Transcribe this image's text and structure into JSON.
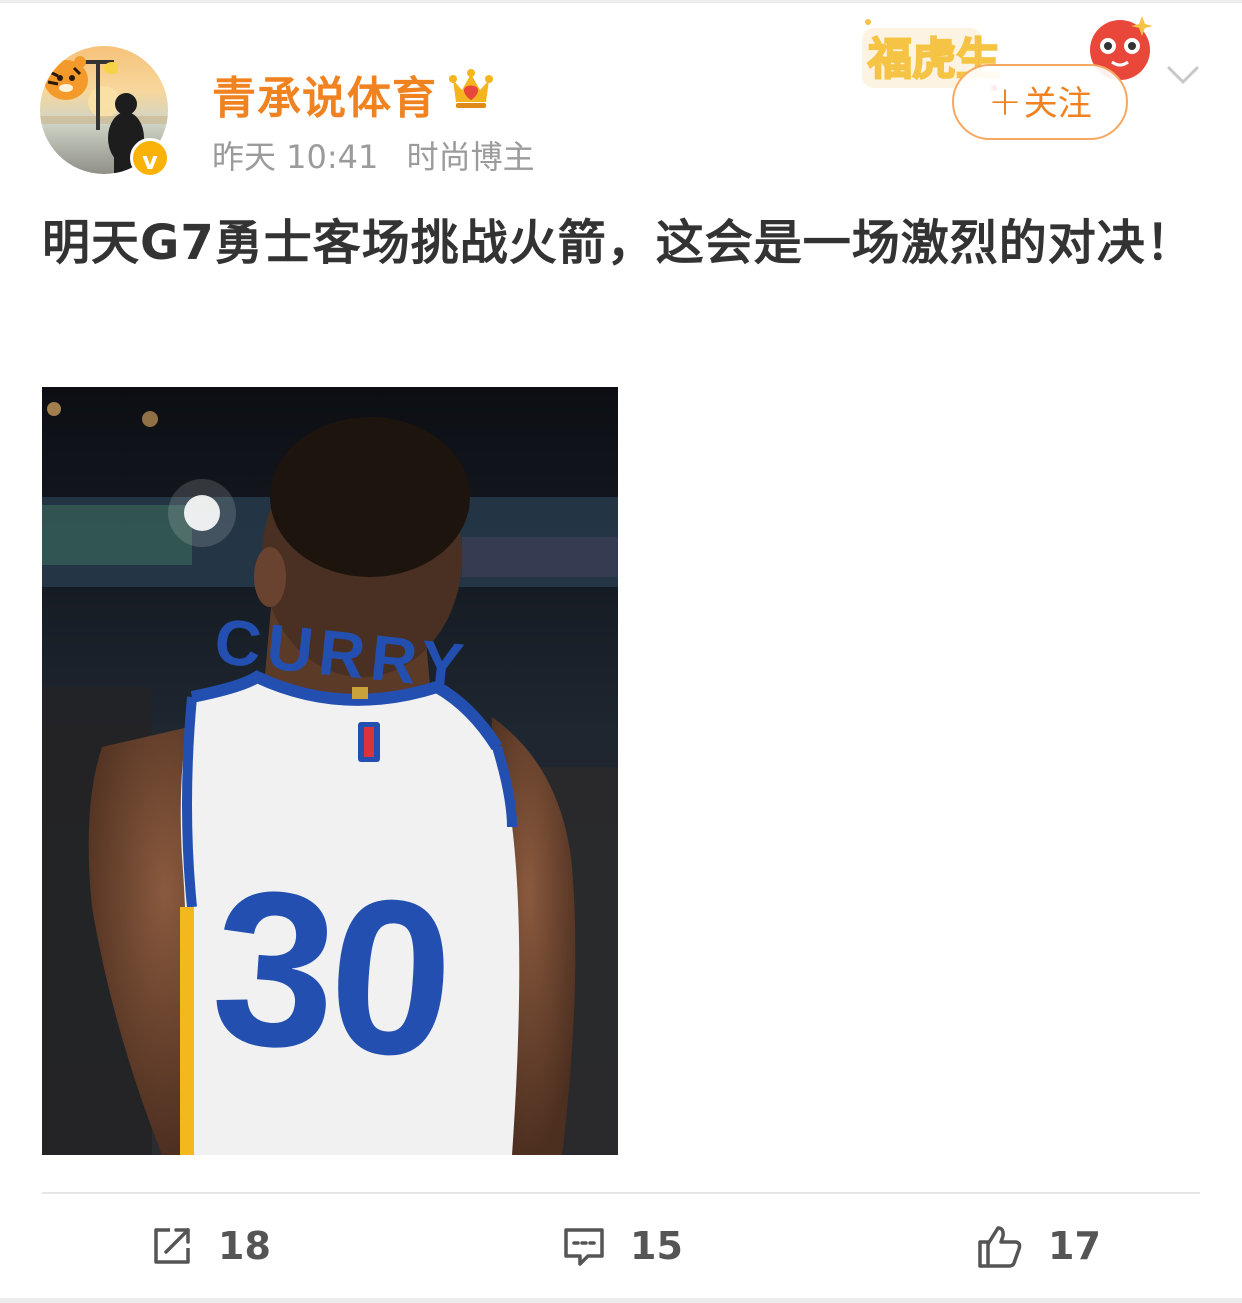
{
  "header": {
    "user_name": "青承说体育",
    "time": "昨天 10:41",
    "user_tag": "时尚博主",
    "verified_badge": "v",
    "follow_button_plus": "+",
    "follow_button_label": "关注",
    "festive_banner_text": "福虎生"
  },
  "post": {
    "text": "明天G7勇士客场挑战火箭，这会是一场激烈的对决！",
    "image": {
      "jersey_name": "CURRY",
      "jersey_number": "30"
    }
  },
  "actions": {
    "repost_count": "18",
    "comment_count": "15",
    "like_count": "17"
  },
  "colors": {
    "accent_orange": "#f08220",
    "verified_yellow": "#f9b208",
    "text_dark": "#333333",
    "meta_gray": "#9b9b9b"
  }
}
